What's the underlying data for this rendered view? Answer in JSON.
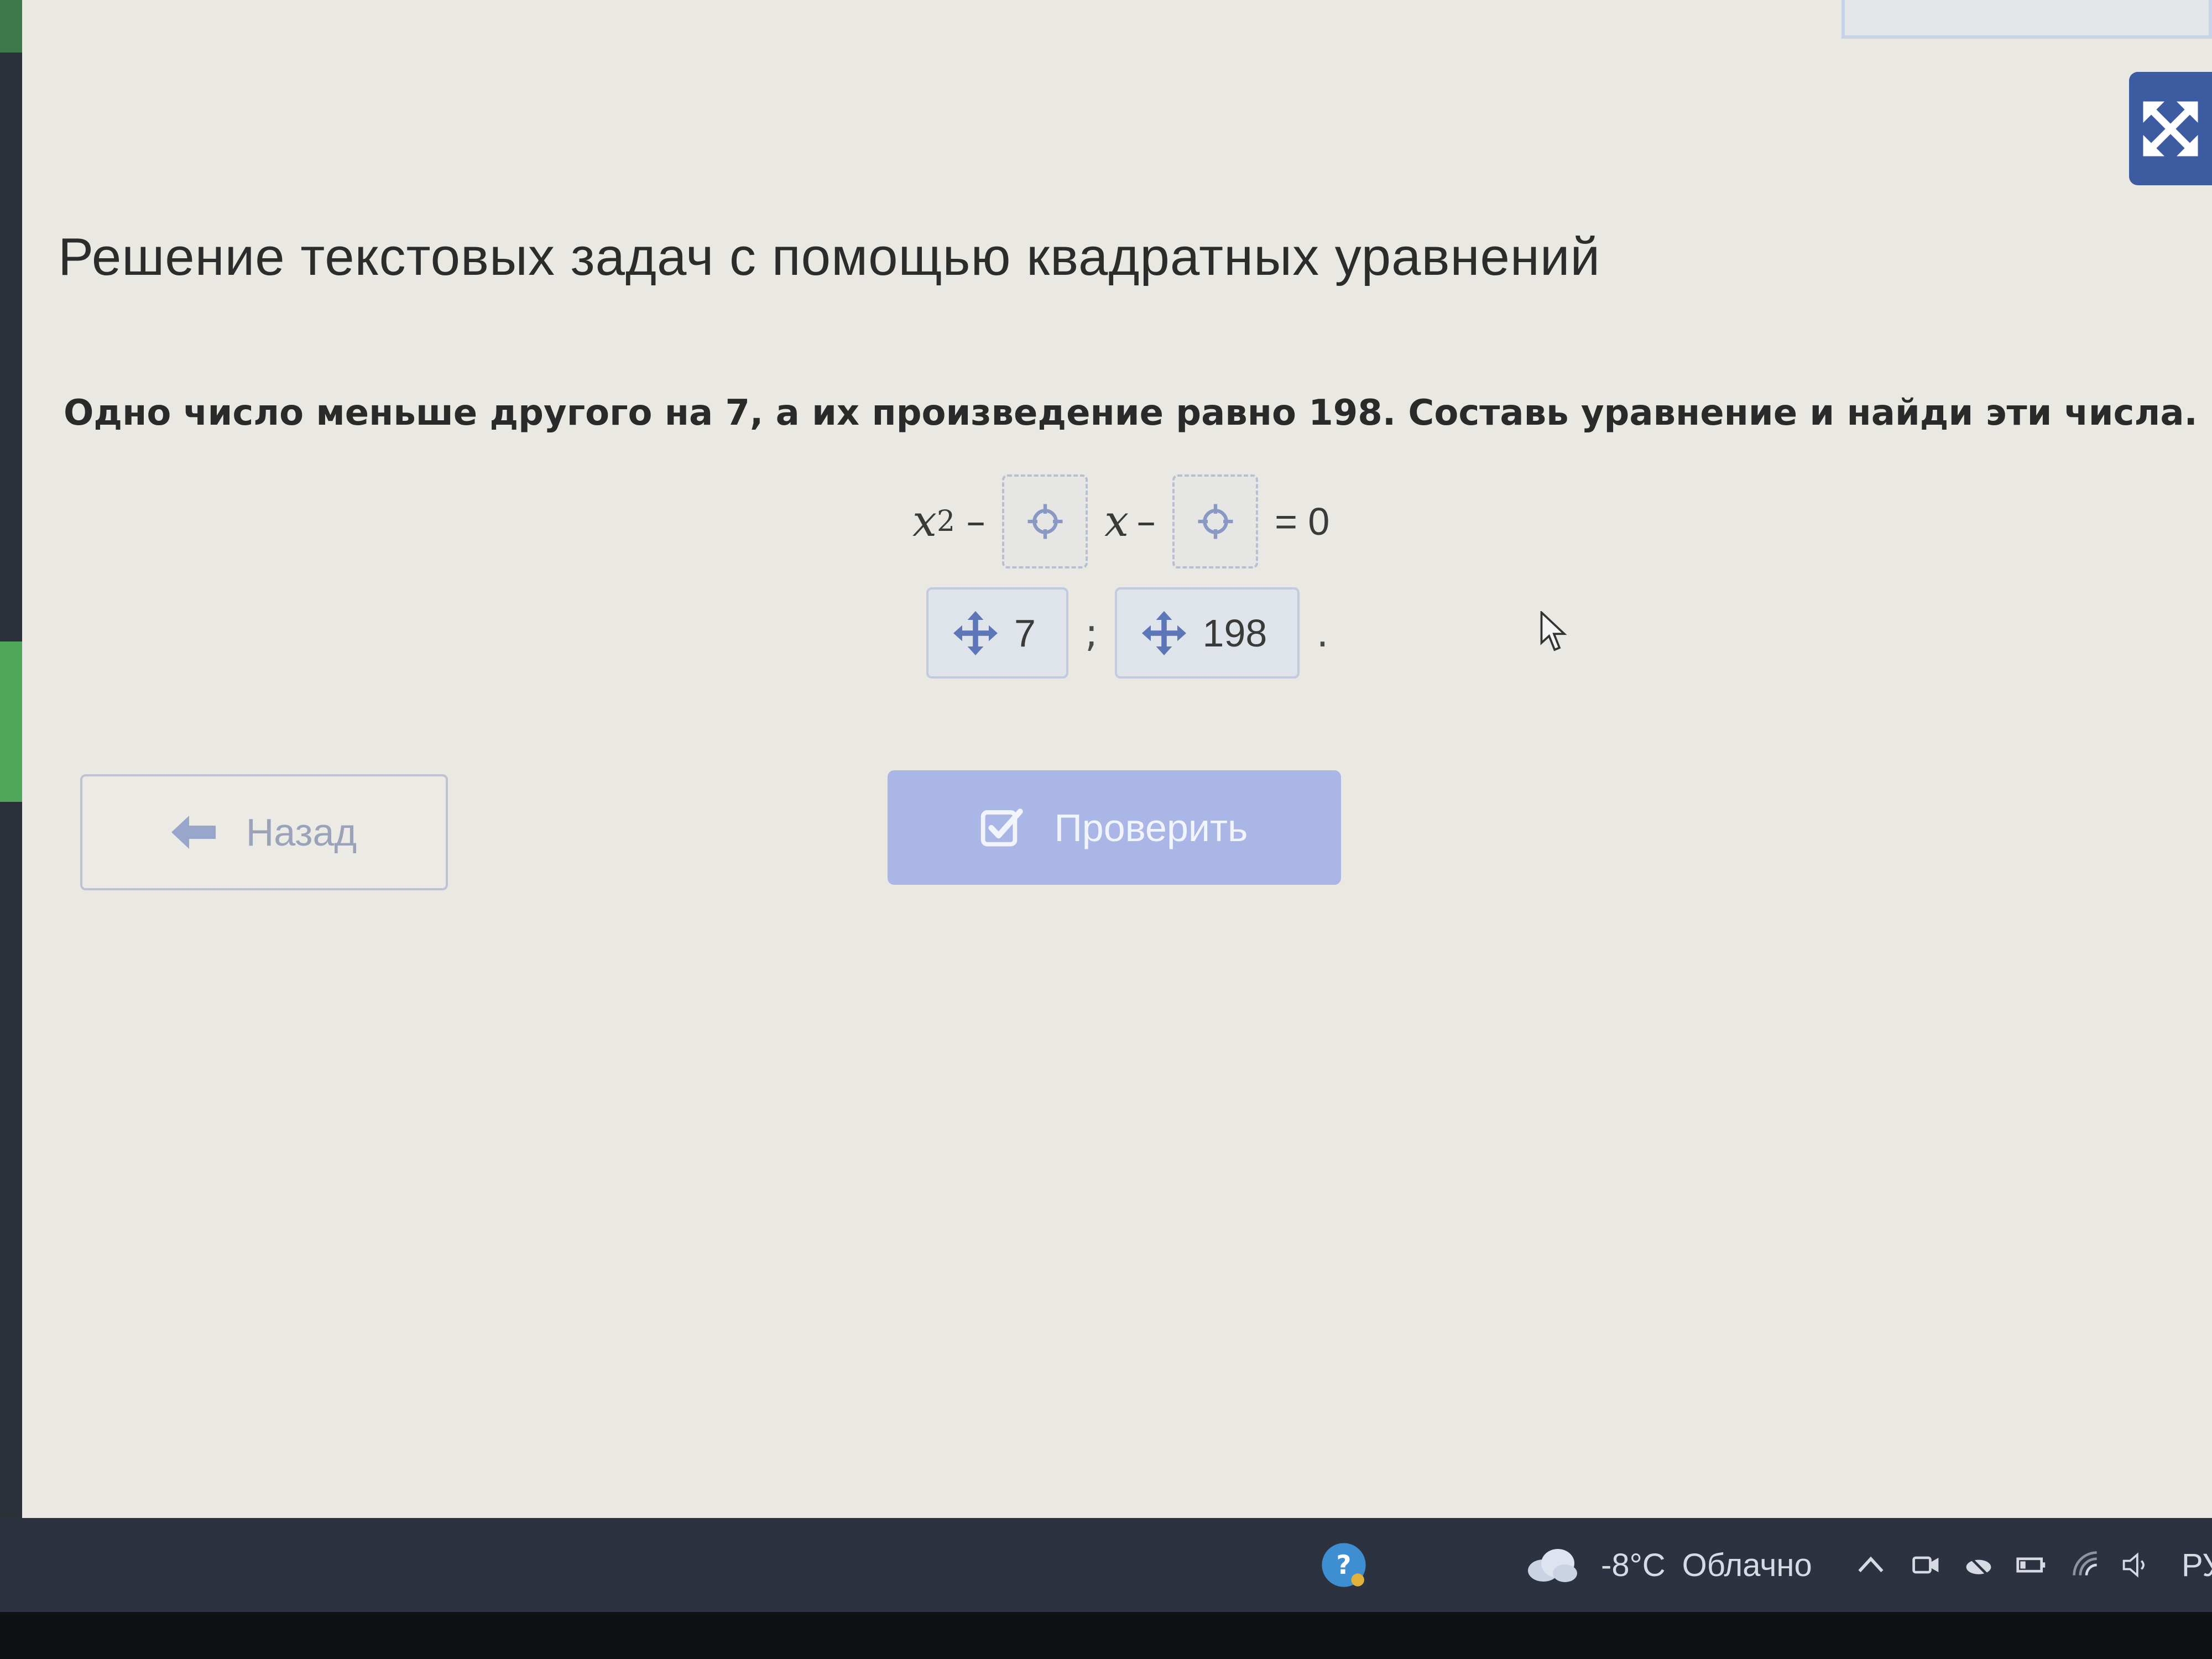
{
  "page": {
    "title": "Решение текстовых задач с помощью квадратных уравнений",
    "task": "Одно число меньше другого на 7, а их произведение равно 198. Составь уравнение и найди эти числа."
  },
  "equation": {
    "variable": "x",
    "exponent": "2",
    "minus1": "–",
    "minus2": "–",
    "equals": "= 0"
  },
  "answer_chips": [
    {
      "label": "7"
    },
    {
      "label": "198"
    }
  ],
  "answer_separator": ";",
  "answer_end": ".",
  "buttons": {
    "back_label": "Назад",
    "check_label": "Проверить"
  },
  "taskbar": {
    "weather_temp": "-8°C",
    "weather_desc": "Облачно",
    "language": "РУ"
  },
  "colors": {
    "accent_blue": "#3d5ba0",
    "check_button_bg": "#aab6e6",
    "content_bg": "#e9e8e3",
    "taskbar_bg": "#2d3240"
  },
  "icons": {
    "fullscreen": "fullscreen-icon",
    "drop_slot": "crosshair-icon",
    "chip_drag": "move-icon",
    "back": "arrow-left-icon",
    "check": "checkbox-icon",
    "weather": "cloud-icon"
  }
}
